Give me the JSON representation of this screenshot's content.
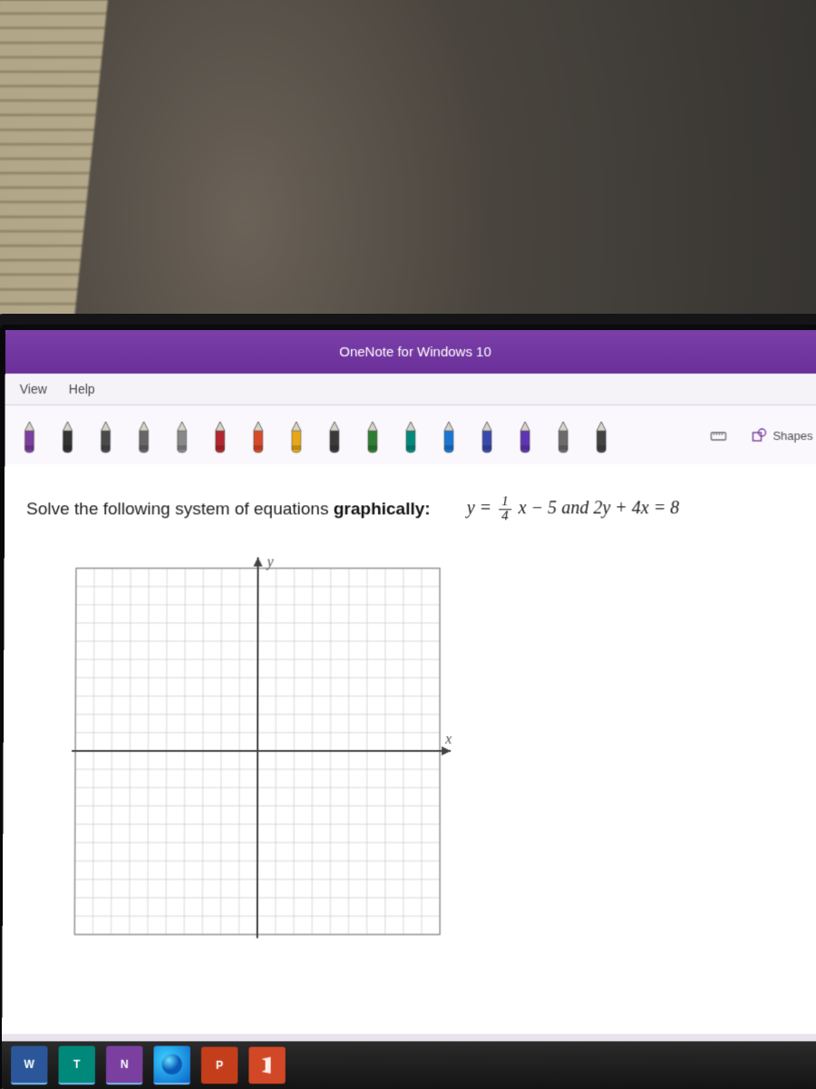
{
  "titlebar": {
    "title": "OneNote for Windows 10"
  },
  "menubar": {
    "view": "View",
    "help": "Help"
  },
  "ribbon": {
    "pens": [
      {
        "color": "#7b3fa0"
      },
      {
        "color": "#333333"
      },
      {
        "color": "#4a4a4a"
      },
      {
        "color": "#666666"
      },
      {
        "color": "#888888"
      },
      {
        "color": "#b2272d"
      },
      {
        "color": "#d64a2a"
      },
      {
        "color": "#e6a817"
      },
      {
        "color": "#3a3a3a"
      },
      {
        "color": "#2e7d32"
      },
      {
        "color": "#00897b"
      },
      {
        "color": "#1976d2"
      },
      {
        "color": "#3949ab"
      },
      {
        "color": "#5e35b1"
      },
      {
        "color": "#6b6b6b"
      },
      {
        "color": "#424242"
      }
    ],
    "shapes_label": "Shapes"
  },
  "problem": {
    "lead": "Solve the following system of equations ",
    "emph": "graphically:",
    "eq1_prefix": "y =",
    "eq1_num": "1",
    "eq1_den": "4",
    "eq1_suffix": "x − 5",
    "conj": " and ",
    "eq2": "2y + 4x = 8"
  },
  "graph": {
    "x_label": "x",
    "y_label": "y",
    "grid_min": -10,
    "grid_max": 10,
    "cell": 20
  },
  "taskbar": {
    "items": [
      "W",
      "T",
      "N",
      "",
      "P",
      ""
    ]
  }
}
